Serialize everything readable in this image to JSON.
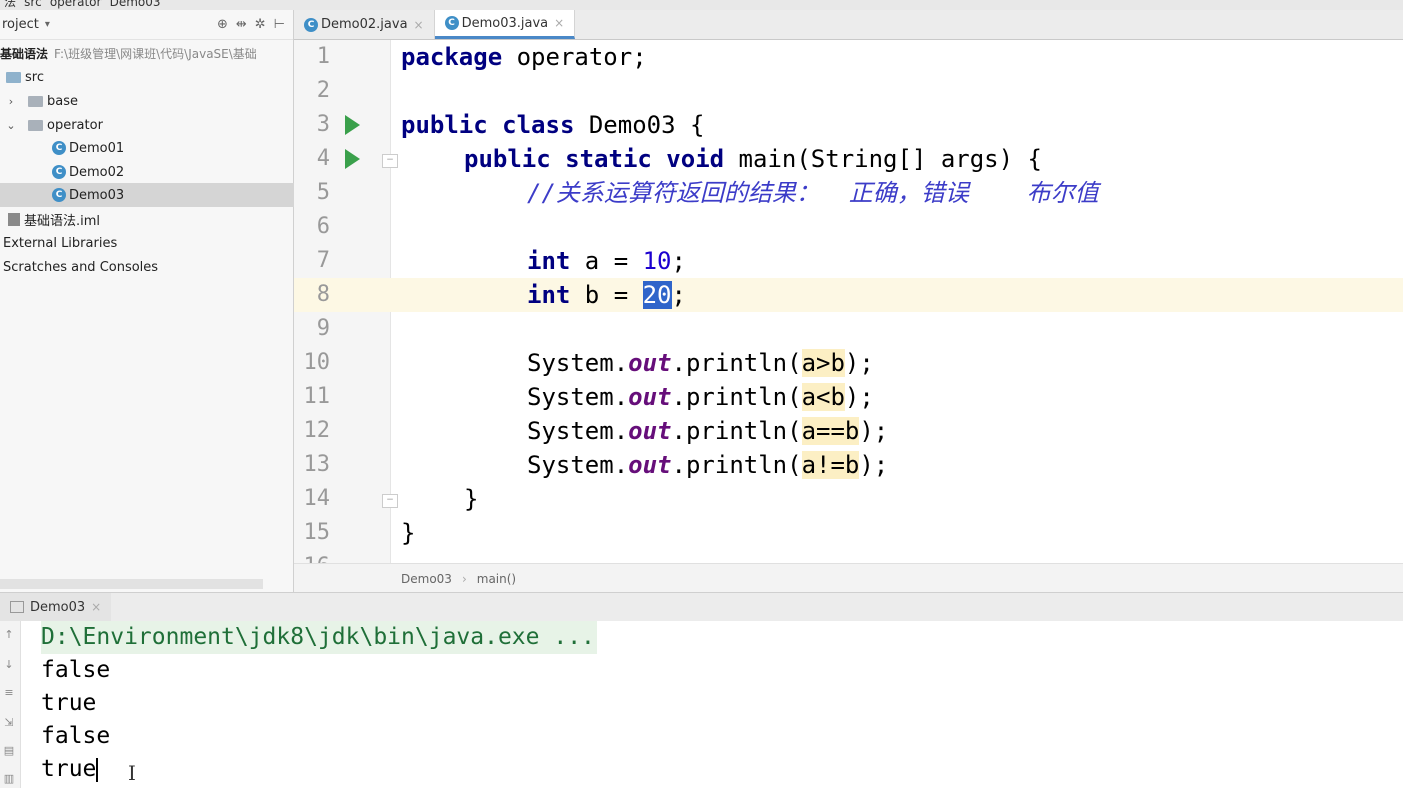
{
  "breadcrumb": [
    "法",
    "src",
    "operator",
    "Demo03"
  ],
  "project": {
    "title": "roject",
    "root_name": "基础语法",
    "root_path": "F:\\班级管理\\网课班\\代码\\JavaSE\\基础",
    "items": [
      {
        "label": "src"
      },
      {
        "label": "base"
      },
      {
        "label": "operator"
      },
      {
        "label": "Demo01"
      },
      {
        "label": "Demo02"
      },
      {
        "label": "Demo03"
      },
      {
        "label": "基础语法.iml"
      },
      {
        "label": "External Libraries"
      },
      {
        "label": "Scratches and Consoles"
      }
    ]
  },
  "tabs": [
    {
      "label": "Demo02.java",
      "active": false
    },
    {
      "label": "Demo03.java",
      "active": true
    }
  ],
  "editor": {
    "line_numbers": [
      "1",
      "2",
      "3",
      "4",
      "5",
      "6",
      "7",
      "8",
      "9",
      "10",
      "11",
      "12",
      "13",
      "14",
      "15",
      "16"
    ],
    "code": {
      "l1_kw": "package",
      "l1_rest": " operator;",
      "l3_kw": "public class",
      "l3_rest": " Demo03 {",
      "l4_kw": "public static void",
      "l4_rest": " main(String[] args) {",
      "l5_comment": "//关系运算符返回的结果：  正确，错误    布尔值",
      "l7_kw": "int",
      "l7_mid": " a = ",
      "l7_num": "10",
      "l7_end": ";",
      "l8_kw": "int",
      "l8_mid": " b = ",
      "l8_num": "20",
      "l8_end": ";",
      "sys": "System.",
      "out": "out",
      "println_open": ".println(",
      "l10_arg": "a>b",
      "l11_arg": "a<b",
      "l12_arg": "a==b",
      "l13_arg": "a!=b",
      "close": ");",
      "l14": "}",
      "l15": "}"
    },
    "breadcrumb": [
      "Demo03",
      "main()"
    ]
  },
  "run": {
    "tab_label": "Demo03",
    "output": [
      "D:\\Environment\\jdk8\\jdk\\bin\\java.exe ...",
      "false",
      "true",
      "false",
      "true"
    ]
  },
  "colors": {
    "keyword": "#000080",
    "number": "#1c00cf",
    "static_field": "#660e7a",
    "comment": "#3c3cc8",
    "run_arrow": "#3aa04b",
    "selection": "#2f65ca"
  }
}
